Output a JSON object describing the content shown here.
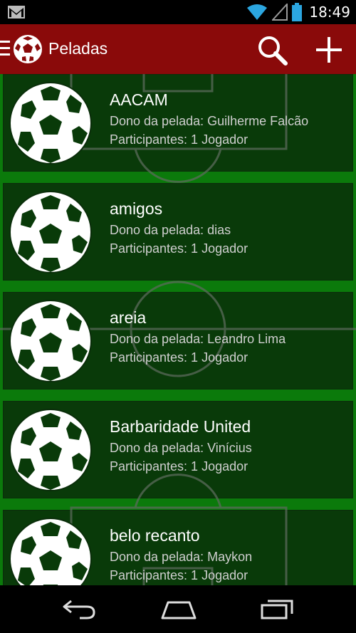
{
  "status_bar": {
    "time": "18:49",
    "icons": [
      "gmail-notification-icon",
      "wifi-icon",
      "cell-signal-icon",
      "battery-icon"
    ]
  },
  "action_bar": {
    "title": "Peladas",
    "menu_icon": "hamburger-menu-icon",
    "logo_icon": "soccer-ball-logo-icon",
    "search_icon": "search-icon",
    "add_icon": "plus-icon",
    "color": "#8a0a0a"
  },
  "peladas": [
    {
      "name": "AACAM",
      "owner": "Dono da pelada: Guilherme Falcão",
      "participants": "Participantes: 1 Jogador"
    },
    {
      "name": "amigos",
      "owner": "Dono da pelada: dias",
      "participants": "Participantes: 1 Jogador"
    },
    {
      "name": "areia",
      "owner": "Dono da pelada: Leandro Lima",
      "participants": "Participantes: 1 Jogador"
    },
    {
      "name": "Barbaridade United",
      "owner": "Dono da pelada: Vinícius",
      "participants": "Participantes: 1 Jogador"
    },
    {
      "name": "belo recanto",
      "owner": "Dono da pelada: Maykon",
      "participants": "Participantes: 1 Jogador"
    }
  ],
  "nav_bar": {
    "icons": [
      "back-icon",
      "home-icon",
      "recent-apps-icon"
    ]
  }
}
